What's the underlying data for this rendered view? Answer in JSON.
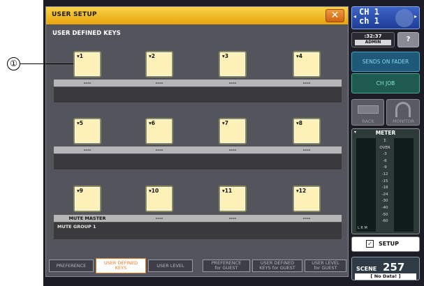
{
  "window": {
    "title": "USER SETUP",
    "close": "✕"
  },
  "section_title": "USER DEFINED KEYS",
  "callout": "①",
  "keys": [
    {
      "num": "1",
      "label": "----",
      "assign": ""
    },
    {
      "num": "2",
      "label": "----",
      "assign": ""
    },
    {
      "num": "3",
      "label": "----",
      "assign": ""
    },
    {
      "num": "4",
      "label": "----",
      "assign": ""
    },
    {
      "num": "5",
      "label": "----",
      "assign": ""
    },
    {
      "num": "6",
      "label": "----",
      "assign": ""
    },
    {
      "num": "7",
      "label": "----",
      "assign": ""
    },
    {
      "num": "8",
      "label": "----",
      "assign": ""
    },
    {
      "num": "9",
      "label": "MUTE MASTER",
      "assign": "MUTE GROUP 1"
    },
    {
      "num": "10",
      "label": "----",
      "assign": ""
    },
    {
      "num": "11",
      "label": "----",
      "assign": ""
    },
    {
      "num": "12",
      "label": "----",
      "assign": ""
    }
  ],
  "tabs": [
    "PREFERENCE",
    "USER DEFINED KEYS",
    "USER LEVEL",
    "PREFERENCE for GUEST",
    "USER DEFINED KEYS for GUEST",
    "USER LEVEL for GUEST"
  ],
  "selected_tab": "USER DEFINED KEYS",
  "right": {
    "ch_line1": "CH 1",
    "ch_line2": "ch 1",
    "time": ":32:37",
    "user": "ADMIN",
    "help": "?",
    "sends": "SENDS ON FADER",
    "chjob": "CH JOB",
    "rack": "RACK",
    "monitor": "MONITOR",
    "meter": {
      "title": "METER",
      "scale": [
        "Σ",
        "OVER",
        "-3",
        "-6",
        "-9",
        "-12",
        "-15",
        "-18",
        "-24",
        "-30",
        "-40",
        "-50",
        "-60"
      ],
      "ch_labels": "L R M"
    },
    "setup": "SETUP",
    "scene_label": "SCENE",
    "scene_num": "257",
    "scene_name": "[ No Data! ]"
  }
}
